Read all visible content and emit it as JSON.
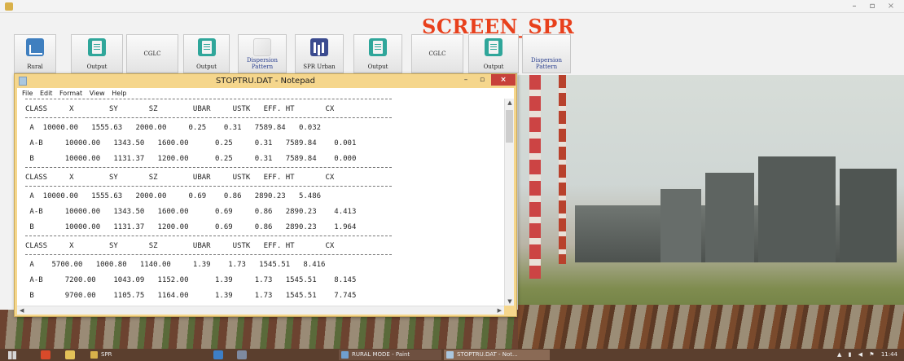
{
  "window": {
    "minimize_glyph": "–",
    "maximize_glyph": "▫",
    "close_glyph": "×"
  },
  "screen_title": "SCREEN_SPR",
  "toolbar": {
    "buttons": [
      {
        "label": "Rural",
        "icon": "rural-icon"
      },
      {
        "label": "Output",
        "icon": "document-icon"
      },
      {
        "label": "CGLC",
        "icon": ""
      },
      {
        "label": "Output",
        "icon": "document-icon"
      },
      {
        "label": "Dispersion Pattern",
        "icon": "dispersion-icon"
      },
      {
        "label": "SPR Urban",
        "icon": "urban-icon"
      },
      {
        "label": "Output",
        "icon": "document-icon"
      },
      {
        "label": "CGLC",
        "icon": ""
      },
      {
        "label": "Output",
        "icon": "document-icon"
      },
      {
        "label": "Dispersion Pattern",
        "icon": ""
      }
    ]
  },
  "notepad": {
    "title": "STOPTRU.DAT - Notepad",
    "menu": [
      "File",
      "Edit",
      "Format",
      "View",
      "Help"
    ],
    "lines": [
      {
        "kind": "header",
        "text": "CLASS     X        SY       SZ        UBAR     USTK   EFF. HT       CX"
      },
      {
        "kind": "row",
        "text": " A  10000.00   1555.63   2000.00     0.25    0.31   7589.84   0.032"
      },
      {
        "kind": "row",
        "text": " A-B     10000.00   1343.50   1600.00      0.25     0.31   7589.84    0.001"
      },
      {
        "kind": "row",
        "text": " B       10000.00   1131.37   1200.00      0.25     0.31   7589.84    0.000"
      },
      {
        "kind": "header",
        "text": "CLASS     X        SY       SZ        UBAR     USTK   EFF. HT       CX"
      },
      {
        "kind": "row",
        "text": " A  10000.00   1555.63   2000.00     0.69    0.86   2890.23   5.486"
      },
      {
        "kind": "row",
        "text": " A-B     10000.00   1343.50   1600.00      0.69     0.86   2890.23    4.413"
      },
      {
        "kind": "row",
        "text": " B       10000.00   1131.37   1200.00      0.69     0.86   2890.23    1.964"
      },
      {
        "kind": "header",
        "text": "CLASS     X        SY       SZ        UBAR     USTK   EFF. HT       CX"
      },
      {
        "kind": "row",
        "text": " A    5700.00   1000.80   1140.00     1.39    1.73   1545.51   8.416"
      },
      {
        "kind": "row",
        "text": " A-B     7200.00    1043.09   1152.00      1.39     1.73   1545.51    8.145"
      },
      {
        "kind": "row",
        "text": " B       9700.00    1105.75   1164.00      1.39     1.73   1545.51    7.745"
      }
    ]
  },
  "taskbar": {
    "items": [
      {
        "label": "SPR",
        "color": "#d9b14a"
      },
      {
        "label": "RURAL MODE - Paint",
        "color": "#6f9fd1"
      },
      {
        "label": "STOPTRU.DAT - Not...",
        "color": "#aac7df"
      }
    ],
    "clock": "11:44"
  },
  "colors": {
    "title_red": "#e8401c",
    "notepad_frame": "#f5d68c",
    "taskbar": "#5b3f2e"
  }
}
